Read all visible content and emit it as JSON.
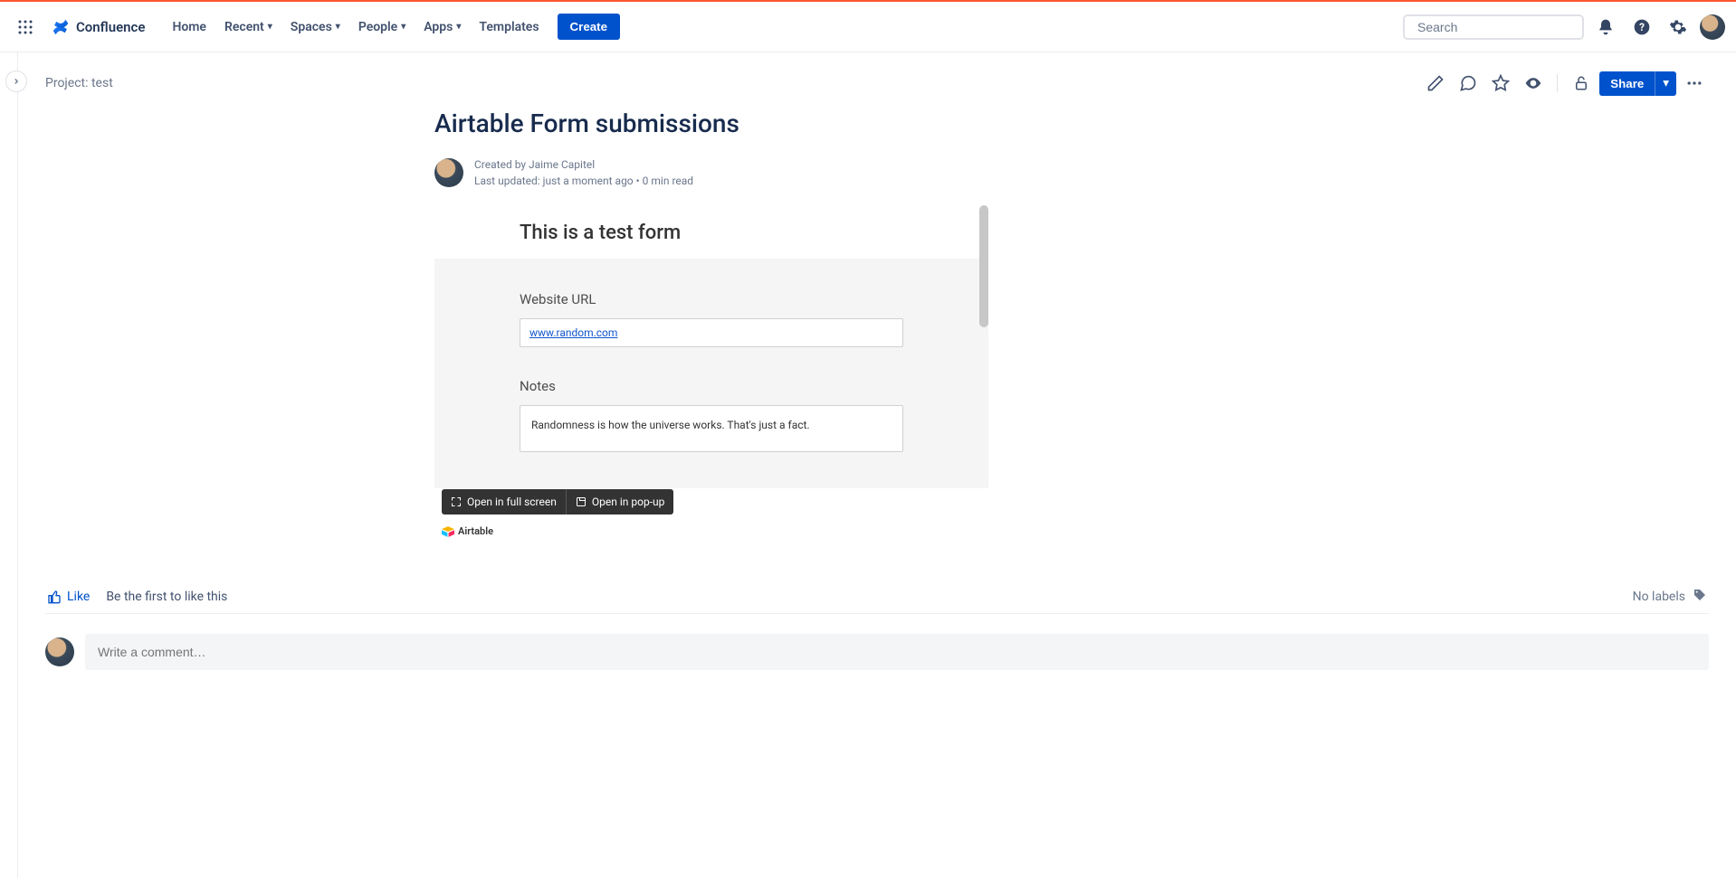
{
  "brand": {
    "name": "Confluence"
  },
  "nav": {
    "home": "Home",
    "recent": "Recent",
    "spaces": "Spaces",
    "people": "People",
    "apps": "Apps",
    "templates": "Templates",
    "create": "Create"
  },
  "search": {
    "placeholder": "Search"
  },
  "breadcrumb": "Project: test",
  "share_label": "Share",
  "page": {
    "title": "Airtable Form submissions",
    "created_by_prefix": "Created by ",
    "author": "Jaime Capitel",
    "updated_line": "Last updated: just a moment ago",
    "read_time": "0 min read"
  },
  "embed": {
    "form_title": "This is a test form",
    "field1_label": "Website URL",
    "field1_value": "www.random.com",
    "field2_label": "Notes",
    "field2_value": "Randomness is how the universe works. That's just a fact.",
    "fullscreen": "Open in full screen",
    "popup": "Open in pop-up",
    "powered_by": "Airtable"
  },
  "social": {
    "like": "Like",
    "first_to_like": "Be the first to like this",
    "no_labels": "No labels"
  },
  "comment": {
    "placeholder": "Write a comment…"
  }
}
